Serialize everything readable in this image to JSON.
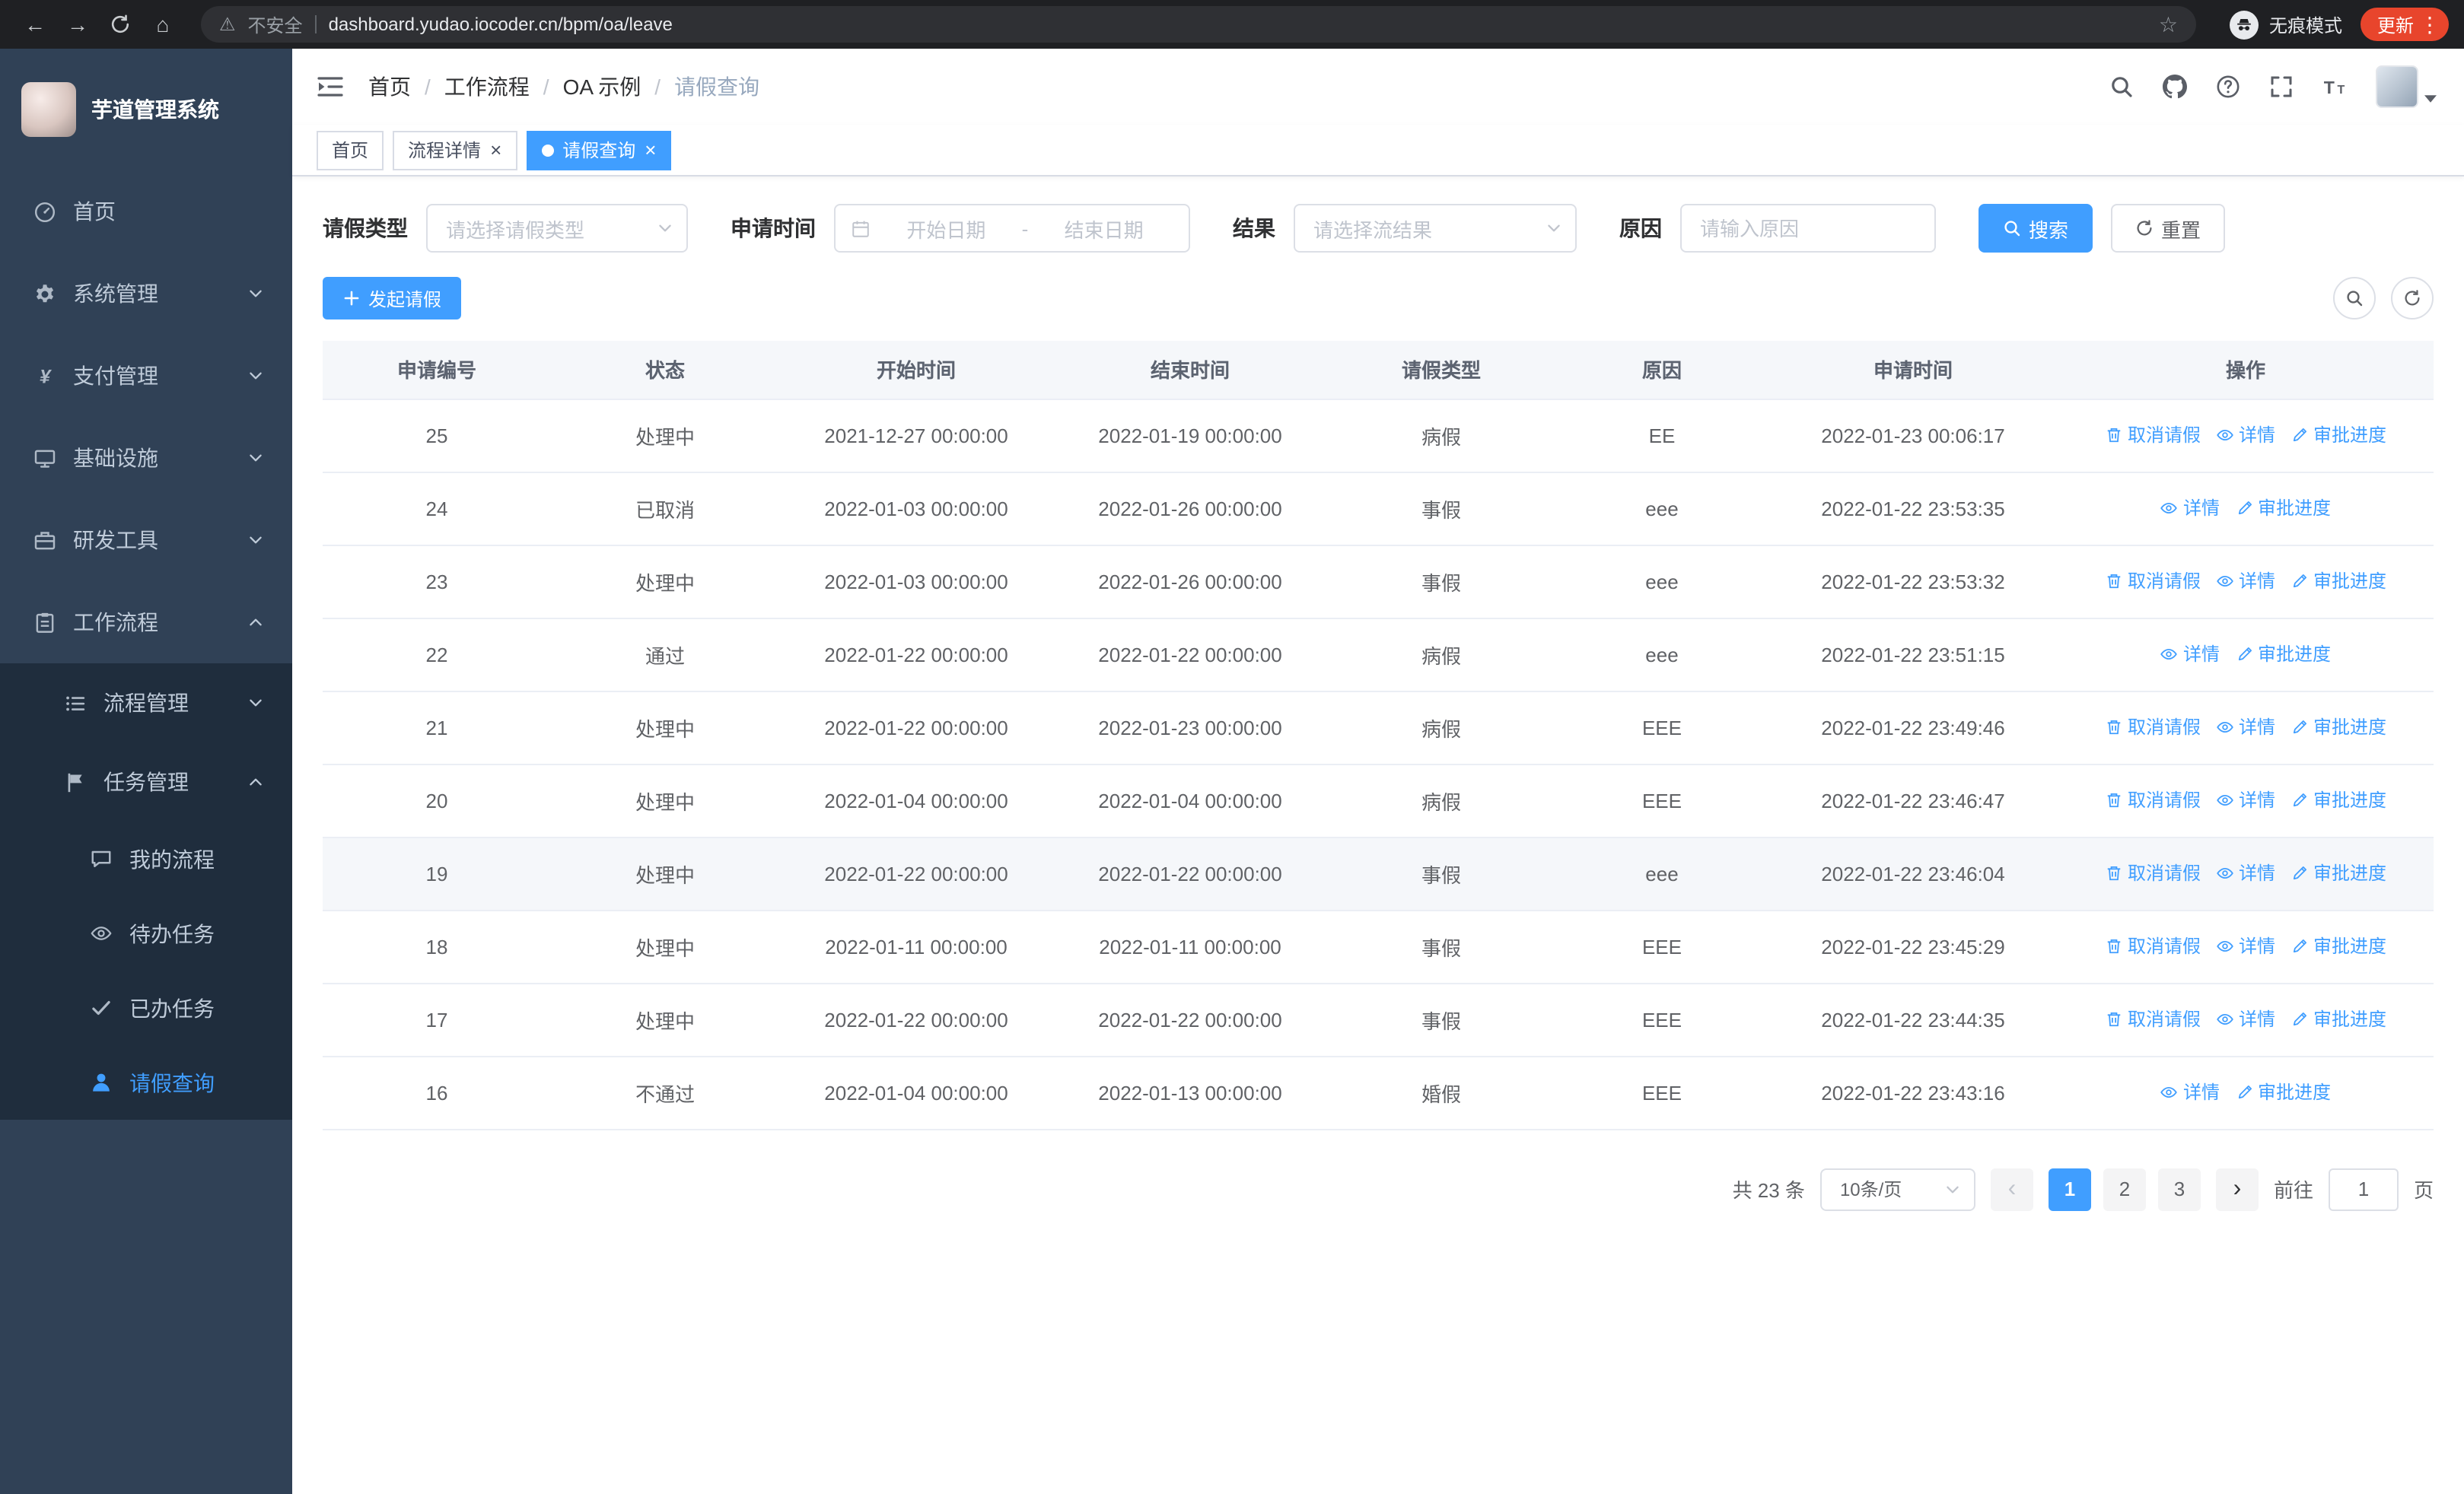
{
  "colors": {
    "primary": "#409EFF",
    "sidebar_bg": "#304156",
    "submenu_bg": "#1f2d3d",
    "update_chip": "#e8452c"
  },
  "browser": {
    "security_text": "不安全",
    "url": "dashboard.yudao.iocoder.cn/bpm/oa/leave",
    "incognito_text": "无痕模式",
    "update_text": "更新"
  },
  "app": {
    "title": "芋道管理系统"
  },
  "sidebar": {
    "menu": [
      {
        "key": "home",
        "label": "首页",
        "icon": "dashboard",
        "level": 1
      },
      {
        "key": "system",
        "label": "系统管理",
        "icon": "gear",
        "level": 1,
        "arrow": "down"
      },
      {
        "key": "payment",
        "label": "支付管理",
        "icon": "yen",
        "level": 1,
        "arrow": "down"
      },
      {
        "key": "infrastructure",
        "label": "基础设施",
        "icon": "monitor",
        "level": 1,
        "arrow": "down"
      },
      {
        "key": "devtools",
        "label": "研发工具",
        "icon": "briefcase",
        "level": 1,
        "arrow": "down"
      },
      {
        "key": "workflow",
        "label": "工作流程",
        "icon": "clipboard",
        "level": 1,
        "arrow": "up"
      },
      {
        "key": "process-mgmt",
        "label": "流程管理",
        "icon": "list",
        "level": 2,
        "sub": true,
        "arrow": "down"
      },
      {
        "key": "task-mgmt",
        "label": "任务管理",
        "icon": "flag",
        "level": 2,
        "sub": true,
        "arrow": "up"
      },
      {
        "key": "my-process",
        "label": "我的流程",
        "icon": "chat",
        "level": 3,
        "sub": true
      },
      {
        "key": "todo-tasks",
        "label": "待办任务",
        "icon": "eye",
        "level": 3,
        "sub": true
      },
      {
        "key": "done-tasks",
        "label": "已办任务",
        "icon": "check",
        "level": 3,
        "sub": true
      },
      {
        "key": "leave-query",
        "label": "请假查询",
        "icon": "user",
        "level": 3,
        "sub": true,
        "active": true
      }
    ]
  },
  "header": {
    "breadcrumb": [
      "首页",
      "工作流程",
      "OA 示例",
      "请假查询"
    ]
  },
  "tabs": [
    {
      "label": "首页",
      "closable": false,
      "active": false
    },
    {
      "label": "流程详情",
      "closable": true,
      "active": false
    },
    {
      "label": "请假查询",
      "closable": true,
      "active": true
    }
  ],
  "filters": {
    "leave_type_label": "请假类型",
    "leave_type_placeholder": "请选择请假类型",
    "apply_time_label": "申请时间",
    "start_placeholder": "开始日期",
    "range_separator": "-",
    "end_placeholder": "结束日期",
    "result_label": "结果",
    "result_placeholder": "请选择流结果",
    "reason_label": "原因",
    "reason_placeholder": "请输入原因",
    "search_text": "搜索",
    "reset_text": "重置"
  },
  "toolbar": {
    "create_text": "发起请假"
  },
  "table": {
    "columns": [
      "申请编号",
      "状态",
      "开始时间",
      "结束时间",
      "请假类型",
      "原因",
      "申请时间",
      "操作"
    ],
    "action_labels": {
      "cancel": "取消请假",
      "detail": "详情",
      "progress": "审批进度"
    },
    "rows": [
      {
        "id": "25",
        "status": "处理中",
        "start_time": "2021-12-27 00:00:00",
        "end_time": "2022-01-19 00:00:00",
        "leave_type": "病假",
        "reason": "EE",
        "apply_time": "2022-01-23 00:06:17",
        "actions": [
          "cancel",
          "detail",
          "progress"
        ],
        "highlight": false
      },
      {
        "id": "24",
        "status": "已取消",
        "start_time": "2022-01-03 00:00:00",
        "end_time": "2022-01-26 00:00:00",
        "leave_type": "事假",
        "reason": "eee",
        "apply_time": "2022-01-22 23:53:35",
        "actions": [
          "detail",
          "progress"
        ],
        "highlight": false
      },
      {
        "id": "23",
        "status": "处理中",
        "start_time": "2022-01-03 00:00:00",
        "end_time": "2022-01-26 00:00:00",
        "leave_type": "事假",
        "reason": "eee",
        "apply_time": "2022-01-22 23:53:32",
        "actions": [
          "cancel",
          "detail",
          "progress"
        ],
        "highlight": false
      },
      {
        "id": "22",
        "status": "通过",
        "start_time": "2022-01-22 00:00:00",
        "end_time": "2022-01-22 00:00:00",
        "leave_type": "病假",
        "reason": "eee",
        "apply_time": "2022-01-22 23:51:15",
        "actions": [
          "detail",
          "progress"
        ],
        "highlight": false
      },
      {
        "id": "21",
        "status": "处理中",
        "start_time": "2022-01-22 00:00:00",
        "end_time": "2022-01-23 00:00:00",
        "leave_type": "病假",
        "reason": "EEE",
        "apply_time": "2022-01-22 23:49:46",
        "actions": [
          "cancel",
          "detail",
          "progress"
        ],
        "highlight": false
      },
      {
        "id": "20",
        "status": "处理中",
        "start_time": "2022-01-04 00:00:00",
        "end_time": "2022-01-04 00:00:00",
        "leave_type": "病假",
        "reason": "EEE",
        "apply_time": "2022-01-22 23:46:47",
        "actions": [
          "cancel",
          "detail",
          "progress"
        ],
        "highlight": false
      },
      {
        "id": "19",
        "status": "处理中",
        "start_time": "2022-01-22 00:00:00",
        "end_time": "2022-01-22 00:00:00",
        "leave_type": "事假",
        "reason": "eee",
        "apply_time": "2022-01-22 23:46:04",
        "actions": [
          "cancel",
          "detail",
          "progress"
        ],
        "highlight": true
      },
      {
        "id": "18",
        "status": "处理中",
        "start_time": "2022-01-11 00:00:00",
        "end_time": "2022-01-11 00:00:00",
        "leave_type": "事假",
        "reason": "EEE",
        "apply_time": "2022-01-22 23:45:29",
        "actions": [
          "cancel",
          "detail",
          "progress"
        ],
        "highlight": false
      },
      {
        "id": "17",
        "status": "处理中",
        "start_time": "2022-01-22 00:00:00",
        "end_time": "2022-01-22 00:00:00",
        "leave_type": "事假",
        "reason": "EEE",
        "apply_time": "2022-01-22 23:44:35",
        "actions": [
          "cancel",
          "detail",
          "progress"
        ],
        "highlight": false
      },
      {
        "id": "16",
        "status": "不通过",
        "start_time": "2022-01-04 00:00:00",
        "end_time": "2022-01-13 00:00:00",
        "leave_type": "婚假",
        "reason": "EEE",
        "apply_time": "2022-01-22 23:43:16",
        "actions": [
          "detail",
          "progress"
        ],
        "highlight": false
      }
    ]
  },
  "pagination": {
    "total_text": "共 23 条",
    "page_size_text": "10条/页",
    "pages": [
      "1",
      "2",
      "3"
    ],
    "active_page": "1",
    "goto_text": "前往",
    "goto_value": "1",
    "page_unit_text": "页"
  }
}
